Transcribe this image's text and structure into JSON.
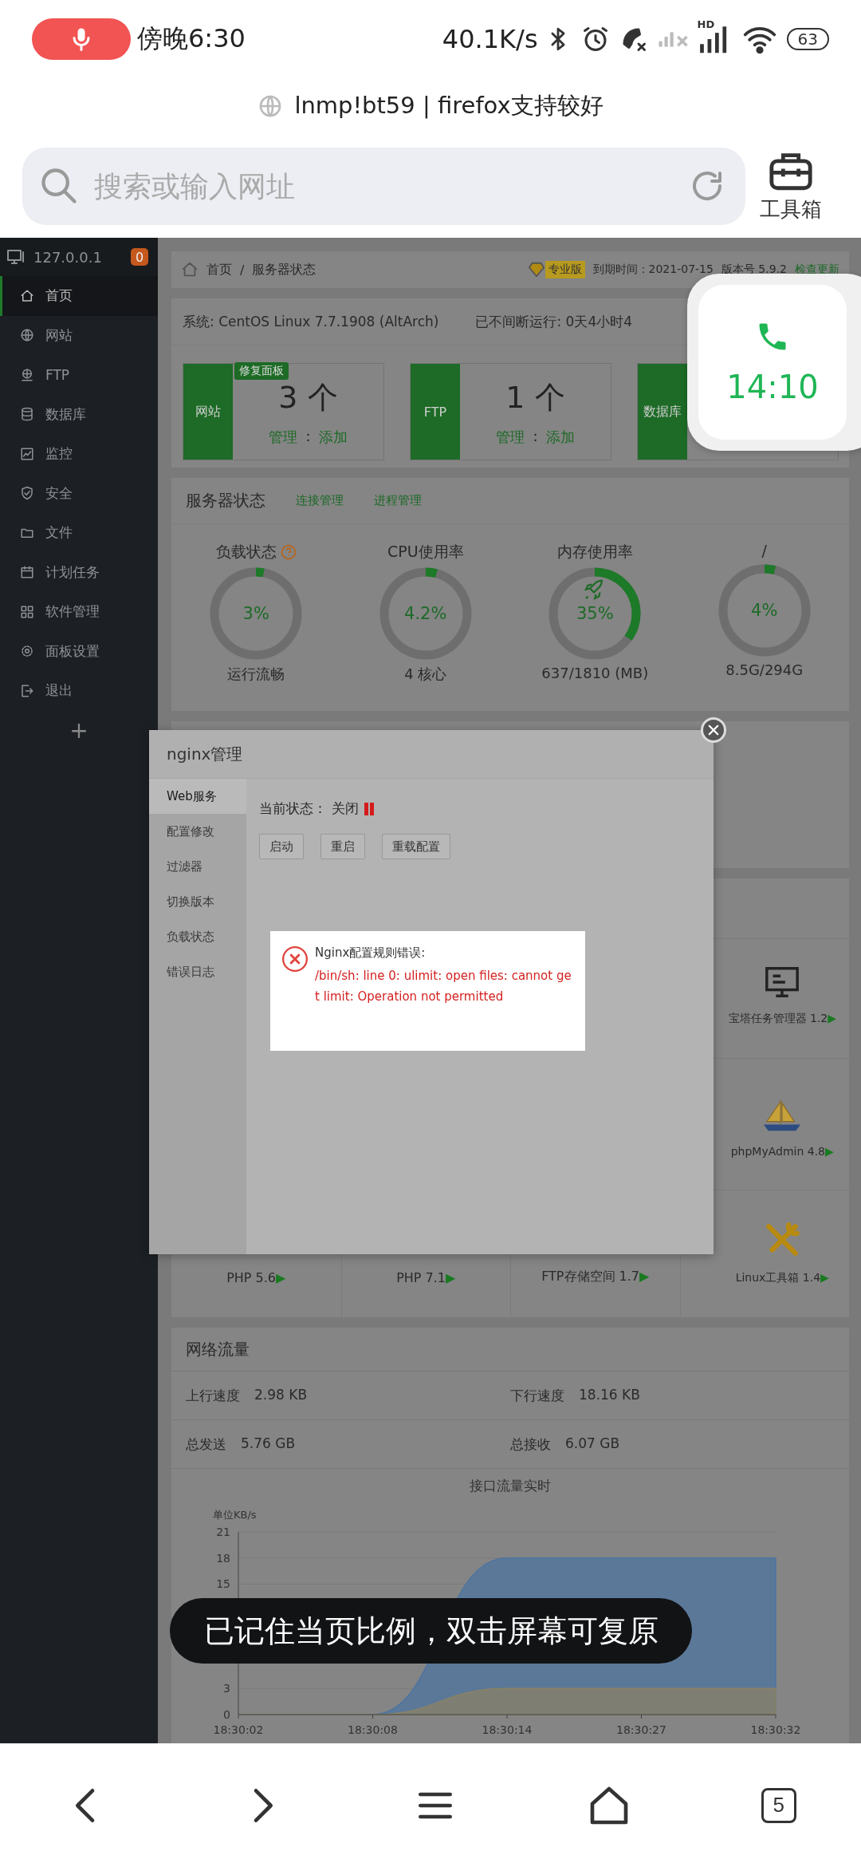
{
  "status_bar": {
    "time": "傍晚6:30",
    "net_speed": "40.1K/s",
    "network_type": "HD",
    "battery": "63"
  },
  "browser": {
    "page_title": "lnmp!bt59 | firefox支持较好",
    "search": {
      "placeholder": "搜索或输入网址"
    },
    "toolbox_label": "工具箱"
  },
  "sidebar": {
    "host": "127.0.0.1",
    "badge": "0",
    "items": [
      {
        "label": "首页",
        "selected": true
      },
      {
        "label": "网站",
        "selected": false
      },
      {
        "label": "FTP",
        "selected": false
      },
      {
        "label": "数据库",
        "selected": false
      },
      {
        "label": "监控",
        "selected": false
      },
      {
        "label": "安全",
        "selected": false
      },
      {
        "label": "文件",
        "selected": false
      },
      {
        "label": "计划任务",
        "selected": false
      },
      {
        "label": "软件管理",
        "selected": false
      },
      {
        "label": "面板设置",
        "selected": false
      },
      {
        "label": "退出",
        "selected": false
      }
    ],
    "add": "+"
  },
  "breadcrumb": {
    "items": [
      "首页",
      "服务器状态"
    ],
    "separator": "/",
    "edition": "专业版",
    "expiry": "到期时间：2021-07-15",
    "version": "版本号 5.9.2",
    "update_link": "检查更新"
  },
  "overview": {
    "system": "系统: CentOS Linux 7.7.1908 (AltArch)",
    "uptime": "已不间断运行: 0天4小时4",
    "stats": [
      {
        "label": "网站",
        "count": "3 个",
        "manage": "管理",
        "link_separator": ":",
        "add": "添加",
        "badge": "修复面板"
      },
      {
        "label": "FTP",
        "count": "1 个",
        "manage": "管理",
        "link_separator": ":",
        "add": "添加"
      },
      {
        "label": "数据库"
      }
    ]
  },
  "server_status": {
    "title": "服务器状态",
    "links": [
      "连接管理",
      "进程管理"
    ],
    "gauges": [
      {
        "kind": "with-help",
        "title": "负载状态",
        "level": 0.03,
        "value": "3%",
        "detail": "运行流畅"
      },
      {
        "kind": "plain",
        "title": "CPU使用率",
        "level": 0.042,
        "value": "4.2%",
        "detail": "4 核心"
      },
      {
        "kind": "with-rocket",
        "title": "内存使用率",
        "level": 0.35,
        "value": "35%",
        "detail": "637/1810 (MB)"
      },
      {
        "kind": "plain",
        "title": "/",
        "level": 0.04,
        "value": "4%",
        "detail": "8.5G/294G"
      }
    ]
  },
  "software": {
    "rows": [
      {
        "apps": [
          {
            "kind": "monitor",
            "name": "宝塔任务管理器 1.2",
            "arrow": "▶"
          }
        ]
      },
      {
        "apps": [
          {
            "kind": "ship",
            "name": "phpMyAdmin 4.8",
            "arrow": "▶"
          }
        ]
      },
      {
        "apps": [
          {
            "kind": "label",
            "name": "PHP 5.6",
            "arrow": "▶"
          },
          {
            "kind": "label",
            "name": "PHP 7.1",
            "arrow": "▶"
          },
          {
            "kind": "label",
            "name": "FTP存储空间 1.7",
            "arrow": "▶"
          },
          {
            "kind": "tools",
            "name": "Linux工具箱 1.4",
            "arrow": "▶"
          }
        ]
      }
    ]
  },
  "network": {
    "title": "网络流量",
    "stats": [
      {
        "label": "上行速度",
        "value": "2.98 KB"
      },
      {
        "label": "下行速度",
        "value": "18.16 KB"
      },
      {
        "label": "总发送",
        "value": "5.76 GB"
      },
      {
        "label": "总接收",
        "value": "6.07 GB"
      }
    ],
    "chart_data": {
      "type": "area",
      "title": "接口流量实时",
      "ylabel": "单位KB/s",
      "categories": [
        "18:30:02",
        "18:30:08",
        "18:30:14",
        "18:30:27",
        "18:30:32"
      ],
      "ylim": [
        0,
        21
      ],
      "yticks": [
        0,
        3,
        15,
        18,
        21
      ],
      "grid": true,
      "series": [
        {
          "color": "#4d74a0",
          "values": [
            0,
            0,
            18,
            18,
            18
          ]
        },
        {
          "color": "#8a8266",
          "values": [
            0,
            0,
            3,
            3,
            3
          ]
        }
      ]
    }
  },
  "dialog": {
    "title": "nginx管理",
    "menu": [
      {
        "label": "Web服务",
        "selected": true
      },
      {
        "label": "配置修改",
        "selected": false
      },
      {
        "label": "过滤器",
        "selected": false
      },
      {
        "label": "切换版本",
        "selected": false
      },
      {
        "label": "负载状态",
        "selected": false
      },
      {
        "label": "错误日志",
        "selected": false
      }
    ],
    "status_label": "当前状态：",
    "status": "关闭",
    "running": false,
    "buttons": [
      "启动",
      "重启",
      "重载配置"
    ],
    "error": {
      "title": "Nginx配置规则错误:",
      "message": "/bin/sh: line 0: ulimit: open files: cannot get limit: Operation not permitted"
    }
  },
  "call_widget": {
    "time": "14:10"
  },
  "toast": {
    "text": "已记住当页比例，双击屏幕可复原"
  },
  "bottom_nav": {
    "tab_count": "5"
  }
}
